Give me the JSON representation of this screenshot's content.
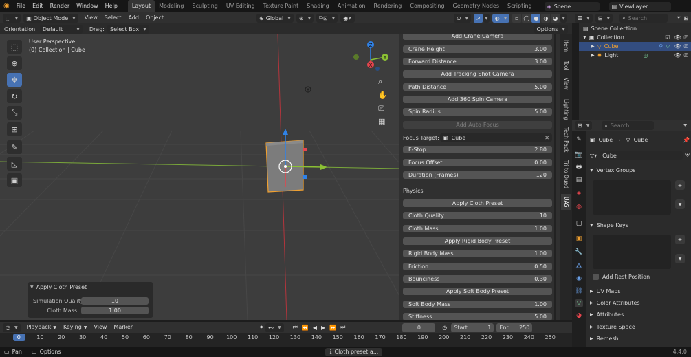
{
  "menu": [
    "File",
    "Edit",
    "Render",
    "Window",
    "Help"
  ],
  "workspaces": [
    "Layout",
    "Modeling",
    "Sculpting",
    "UV Editing",
    "Texture Paint",
    "Shading",
    "Animation",
    "Rendering",
    "Compositing",
    "Geometry Nodes",
    "Scripting"
  ],
  "active_workspace": "Layout",
  "scene": "Scene",
  "view_layer": "ViewLayer",
  "viewport_header": {
    "mode": "Object Mode",
    "menus": [
      "View",
      "Select",
      "Add",
      "Object"
    ],
    "transform": "Global",
    "options": "Options"
  },
  "tool_settings": {
    "orientation_label": "Orientation:",
    "orientation": "Default",
    "drag_label": "Drag:",
    "drag": "Select Box"
  },
  "viewport": {
    "title": "User Perspective",
    "subtitle": "(0) Collection | Cube",
    "gizmo_x": "X",
    "gizmo_y": "Y",
    "gizmo_z": "Z"
  },
  "npanel": {
    "tabs": [
      "Item",
      "Tool",
      "View",
      "Lighting",
      "Tech Pack",
      "Tri to Quad",
      "UAS"
    ],
    "add_crane": "Add Crane Camera",
    "crane_height": {
      "label": "Crane Height",
      "value": "3.00"
    },
    "forward_distance": {
      "label": "Forward Distance",
      "value": "3.00"
    },
    "add_tracking": "Add Tracking Shot Camera",
    "path_distance": {
      "label": "Path Distance",
      "value": "5.00"
    },
    "add_spin": "Add 360 Spin Camera",
    "spin_radius": {
      "label": "Spin Radius",
      "value": "5.00"
    },
    "add_autofocus": "Add Auto-Focus",
    "focus_target": {
      "label": "Focus Target:",
      "value": "Cube"
    },
    "fstop": {
      "label": "F-Stop",
      "value": "2.80"
    },
    "focus_offset": {
      "label": "Focus Offset",
      "value": "0.00"
    },
    "duration": {
      "label": "Duration (Frames)",
      "value": "120"
    },
    "physics_label": "Physics",
    "apply_cloth": "Apply Cloth Preset",
    "cloth_quality": {
      "label": "Cloth Quality",
      "value": "10"
    },
    "cloth_mass": {
      "label": "Cloth Mass",
      "value": "1.00"
    },
    "apply_rigid": "Apply Rigid Body Preset",
    "rigid_mass": {
      "label": "Rigid Body Mass",
      "value": "1.00"
    },
    "friction": {
      "label": "Friction",
      "value": "0.50"
    },
    "bounciness": {
      "label": "Bounciness",
      "value": "0.30"
    },
    "apply_soft": "Apply Soft Body Preset",
    "soft_mass": {
      "label": "Soft Body Mass",
      "value": "1.00"
    },
    "stiffness": {
      "label": "Stiffness",
      "value": "5.00"
    }
  },
  "last_operator": {
    "title": "Apply Cloth Preset",
    "sim_quality": {
      "label": "Simulation Quality",
      "value": "10"
    },
    "cloth_mass": {
      "label": "Cloth Mass",
      "value": "1.00"
    }
  },
  "outliner": {
    "search_placeholder": "Search",
    "root": "Scene Collection",
    "collection": "Collection",
    "items": [
      "Cube",
      "Light"
    ]
  },
  "properties": {
    "search_placeholder": "Search",
    "breadcrumb_obj": "Cube",
    "breadcrumb_data": "Cube",
    "mesh_name": "Cube",
    "sections": {
      "vertex_groups": "Vertex Groups",
      "shape_keys": "Shape Keys",
      "add_rest_position": "Add Rest Position",
      "uv_maps": "UV Maps",
      "color_attributes": "Color Attributes",
      "attributes": "Attributes",
      "texture_space": "Texture Space",
      "remesh": "Remesh"
    }
  },
  "timeline": {
    "menus": [
      "Playback",
      "Keying",
      "View",
      "Marker"
    ],
    "current_frame": "0",
    "start_label": "Start",
    "start": "1",
    "end_label": "End",
    "end": "250",
    "ticks": [
      "0",
      "10",
      "20",
      "30",
      "40",
      "50",
      "60",
      "70",
      "80",
      "90",
      "100",
      "110",
      "120",
      "130",
      "140",
      "150",
      "160",
      "170",
      "180",
      "190",
      "200",
      "210",
      "220",
      "230",
      "240",
      "250"
    ]
  },
  "status": {
    "pan": "Pan",
    "options": "Options",
    "message": "Cloth preset a...",
    "version": "4.4.0"
  },
  "colors": {
    "accent": "#4772b3",
    "cube": "#f0a030",
    "x_axis": "#e5454d",
    "y_axis": "#8bc034",
    "z_axis": "#2f82e8"
  }
}
